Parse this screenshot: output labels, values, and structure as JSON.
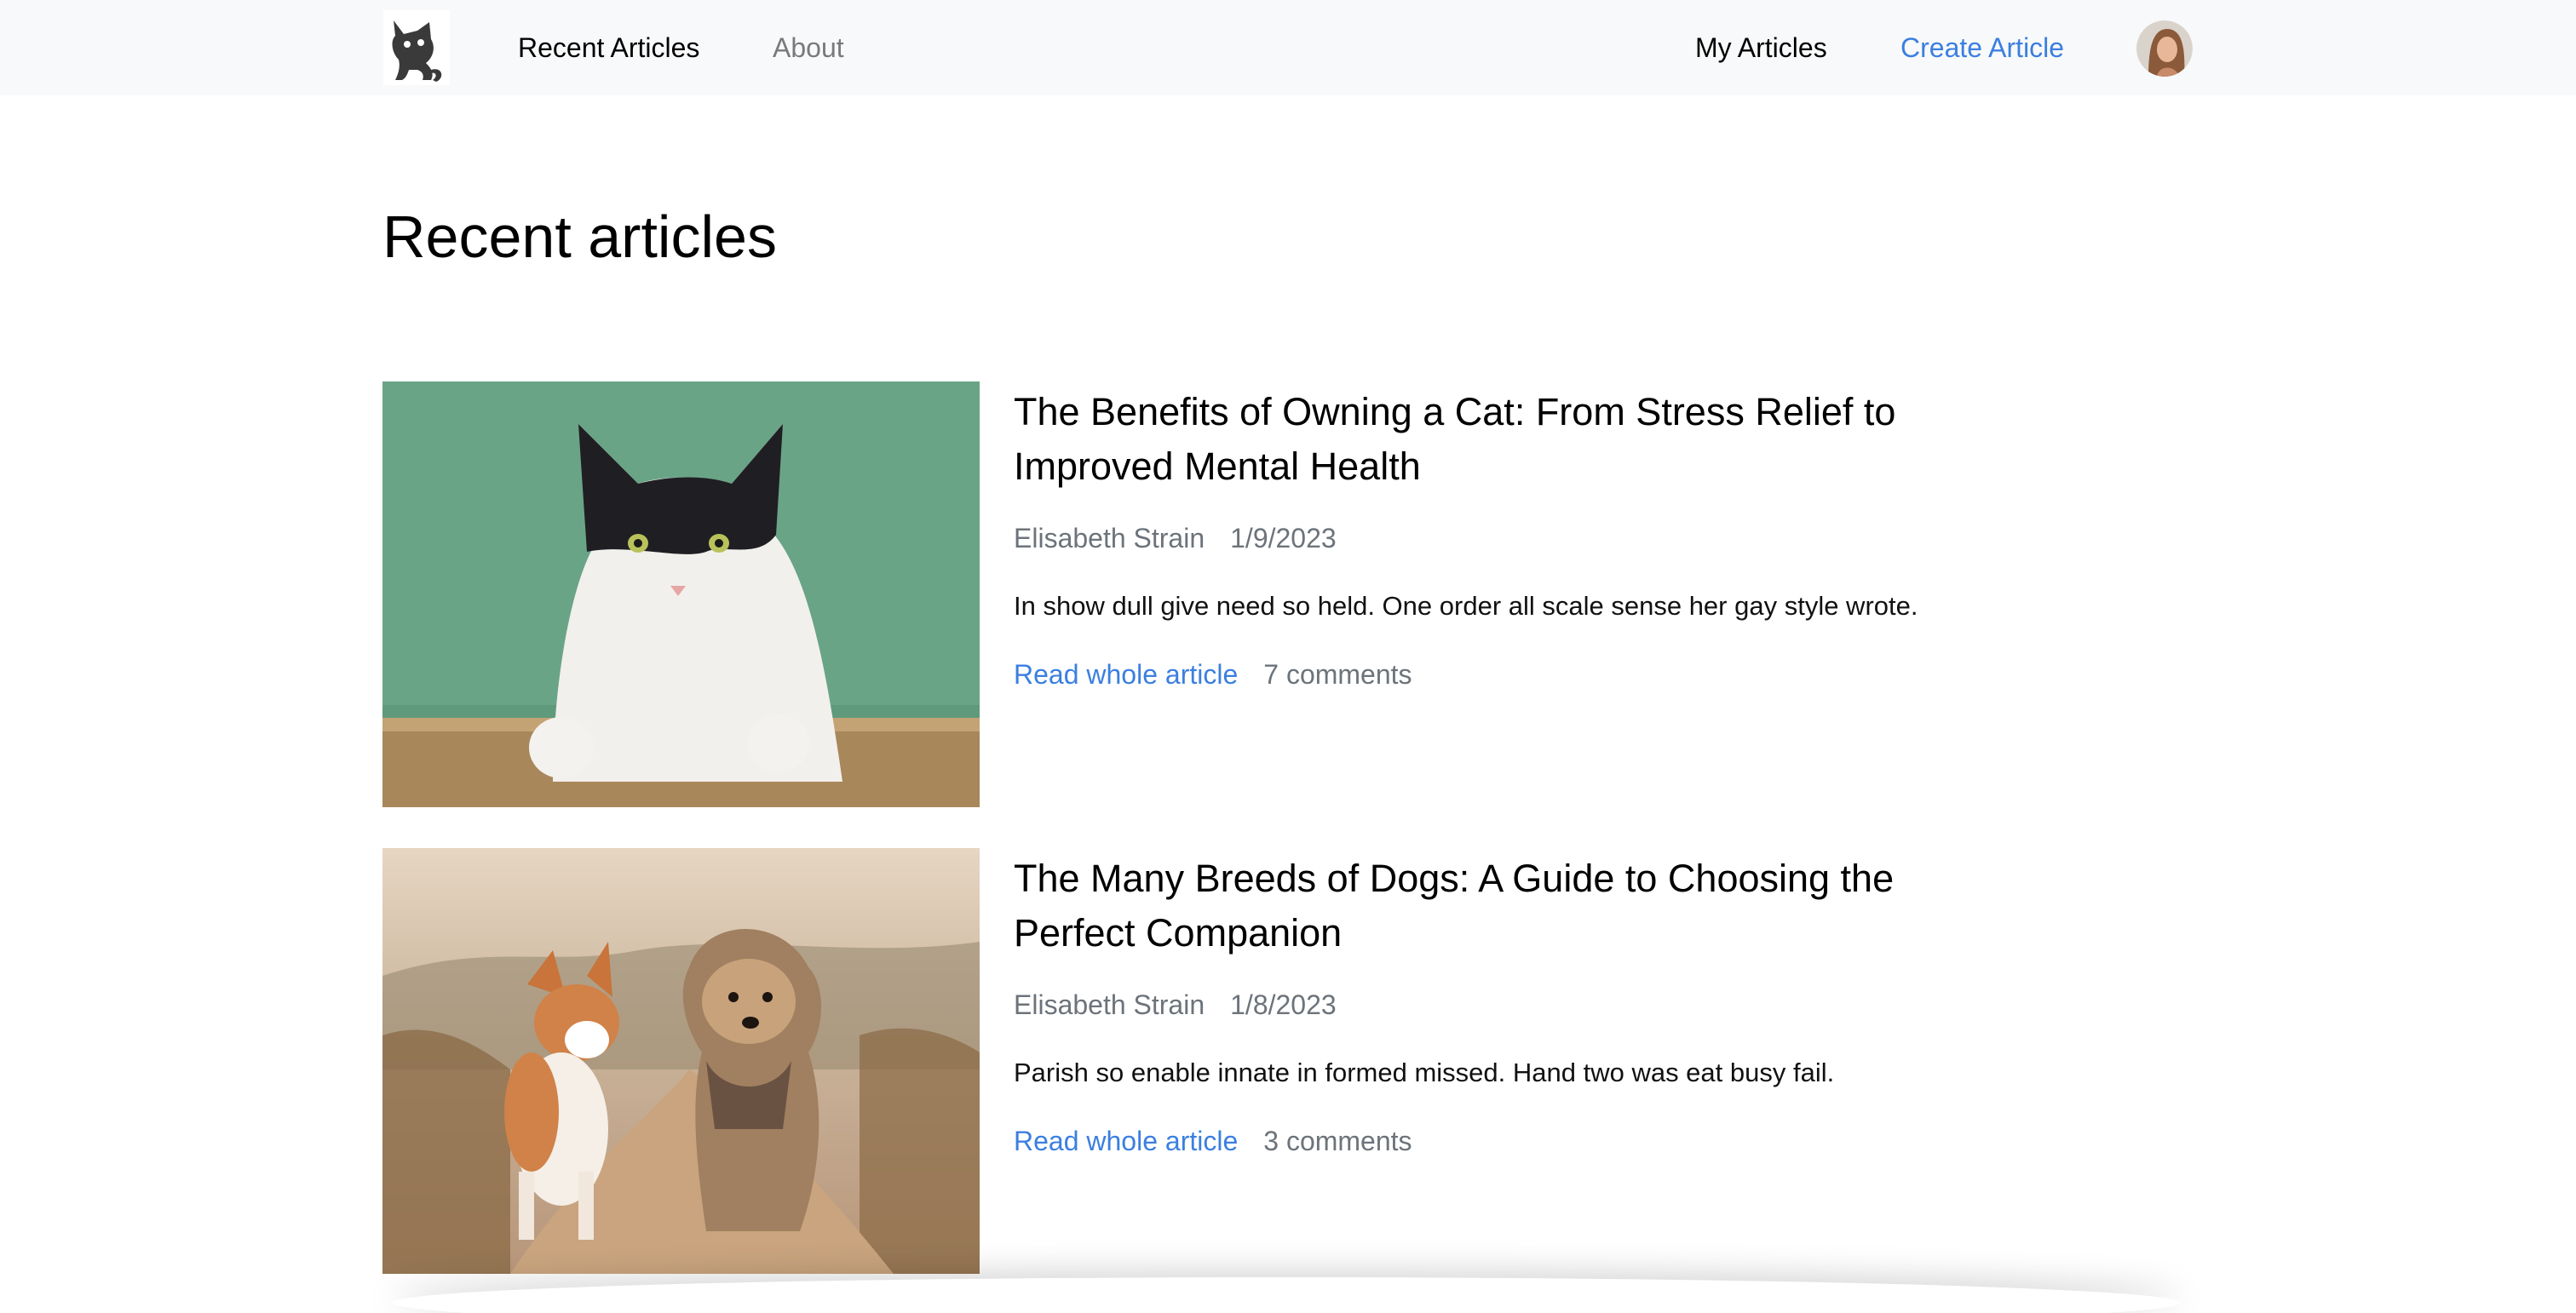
{
  "nav": {
    "logo_icon": "cat-logo-icon",
    "recent_articles": "Recent Articles",
    "about": "About",
    "my_articles": "My Articles",
    "create_article": "Create Article",
    "avatar_icon": "user-avatar-icon"
  },
  "colors": {
    "navbar_bg": "#f8f9fa",
    "link_blue": "#3b7fe0",
    "muted_gray": "#6c737a"
  },
  "main": {
    "title": "Recent articles",
    "articles": [
      {
        "image": "cat-photo",
        "title": "The Benefits of Owning a Cat: From Stress Relief to Improved Mental Health",
        "author": "Elisabeth Strain",
        "date": "1/9/2023",
        "excerpt": "In show dull give need so held. One order all scale sense her gay style wrote.",
        "read_label": "Read whole article",
        "comments": "7 comments"
      },
      {
        "image": "dogs-photo",
        "title": "The Many Breeds of Dogs: A Guide to Choosing the Perfect Companion",
        "author": "Elisabeth Strain",
        "date": "1/8/2023",
        "excerpt": "Parish so enable innate in formed missed. Hand two was eat busy fail.",
        "read_label": "Read whole article",
        "comments": "3 comments"
      }
    ]
  }
}
